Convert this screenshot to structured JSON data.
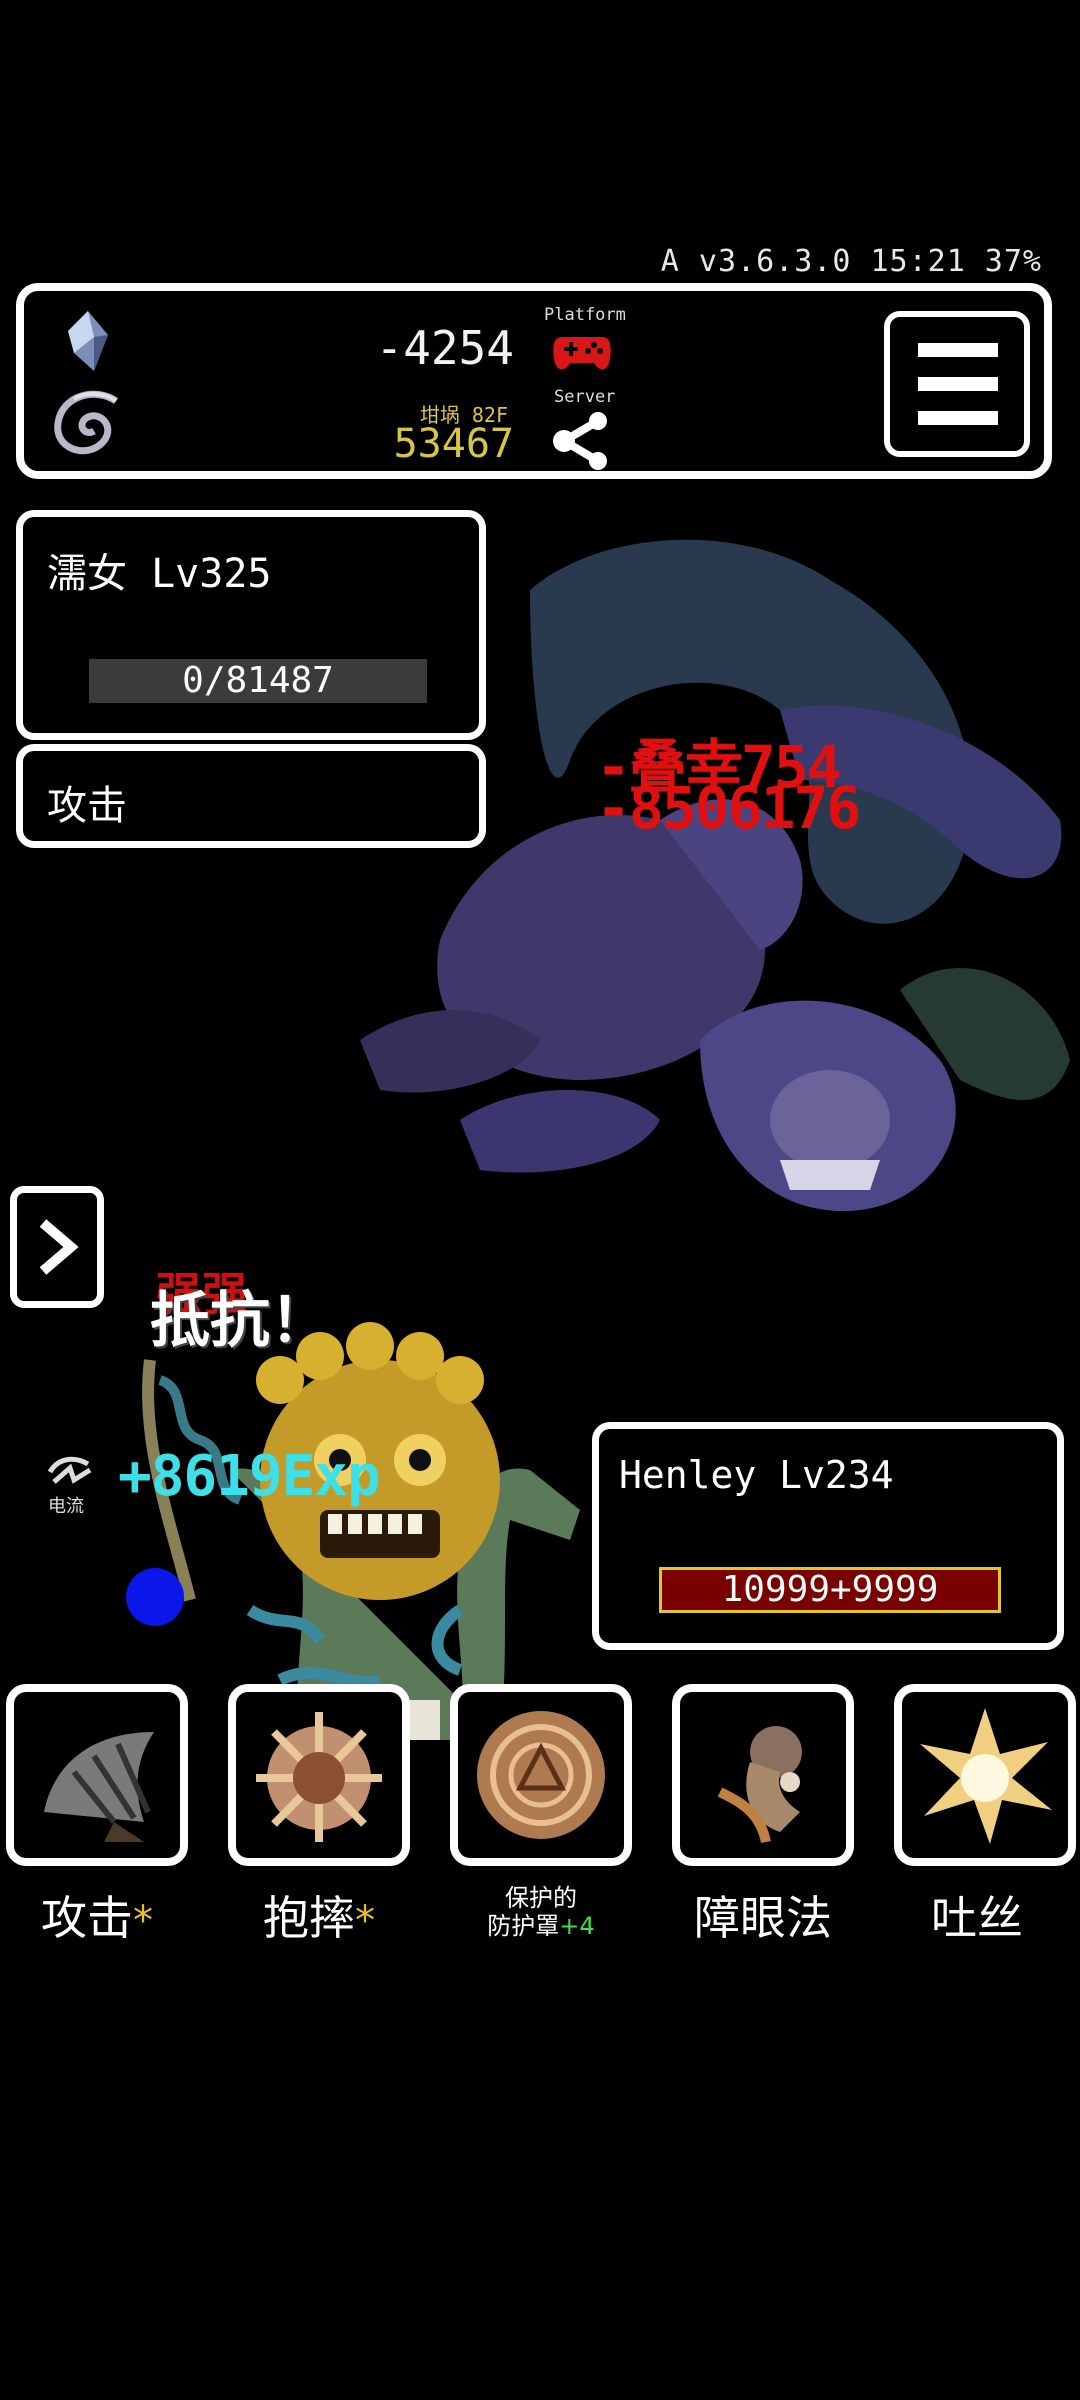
{
  "status_bar": {
    "text": "A v3.6.3.0 15:21 37%"
  },
  "header": {
    "crystal_value": "-4254",
    "floor_label": "坩埚 82F",
    "gold_value": "53467",
    "platform_label": "Platform",
    "server_label": "Server",
    "icons": [
      "crystal-icon",
      "swirl-icon",
      "gamepad-icon",
      "share-icon",
      "menu-icon"
    ]
  },
  "enemy": {
    "name_level": "濡女 Lv325",
    "hp": "0/81487",
    "action": "攻击"
  },
  "combat": {
    "damage_text_1": "-叠幸754",
    "damage_text_2": "-8506176",
    "resist_top": "强强",
    "resist_text": "抵抗！",
    "exp_gain": "+8619Exp",
    "element_label": "电流"
  },
  "player": {
    "name_level": "Henley Lv234",
    "hp": "10999+9999"
  },
  "skills": [
    {
      "label": "攻击",
      "star": "*"
    },
    {
      "label": "抱摔",
      "star": "*"
    },
    {
      "label_line1": "保护的",
      "label_line2": "防护罩",
      "plus": "+4"
    },
    {
      "label": "障眼法"
    },
    {
      "label": "吐丝"
    }
  ],
  "colors": {
    "damage_red": "#e01010",
    "exp_cyan": "#3ee0e8",
    "gold_yellow": "#d8c640",
    "player_hp_bar": "#7a0000",
    "player_hp_border": "#e0c820"
  }
}
